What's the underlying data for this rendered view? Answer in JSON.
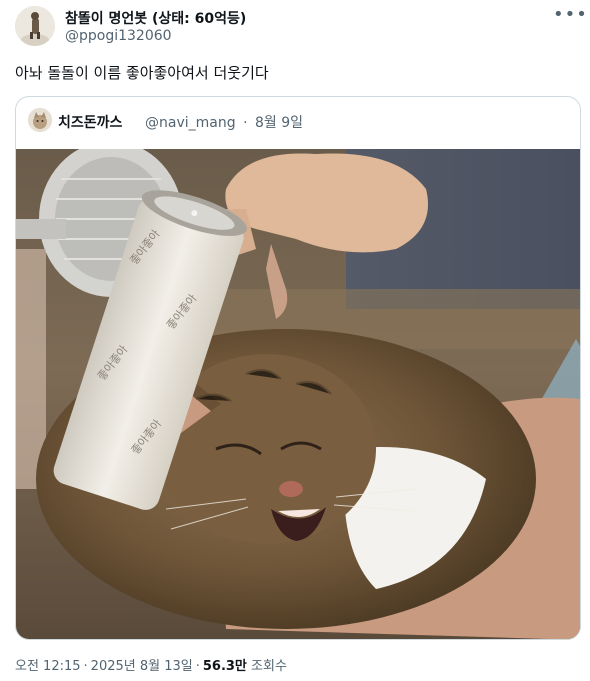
{
  "tweet": {
    "author": {
      "display_name": "참똘이 명언봇 (상태: 60억등)",
      "handle": "@ppogi132060",
      "avatar_icon": "avatar-image"
    },
    "more_icon": "more-horizontal-icon",
    "text": "아놔 돌돌이 이름 좋아좋아여서 더웃기다",
    "quote": {
      "author": {
        "display_name": "치즈돈까스",
        "handle": "@navi_mang",
        "date": "8월 9일"
      },
      "separator": "·",
      "image": {
        "description_icon": "cat-photo",
        "roller_text": "좋아좋아"
      }
    },
    "footer": {
      "time": "오전 12:15",
      "date": "2025년 8월 13일",
      "separator": "·",
      "views_count": "56.3만",
      "views_label": "조회수"
    }
  },
  "colors": {
    "primary_text": "#0f1419",
    "secondary_text": "#536471",
    "border": "#cfd9de",
    "background": "#ffffff"
  }
}
